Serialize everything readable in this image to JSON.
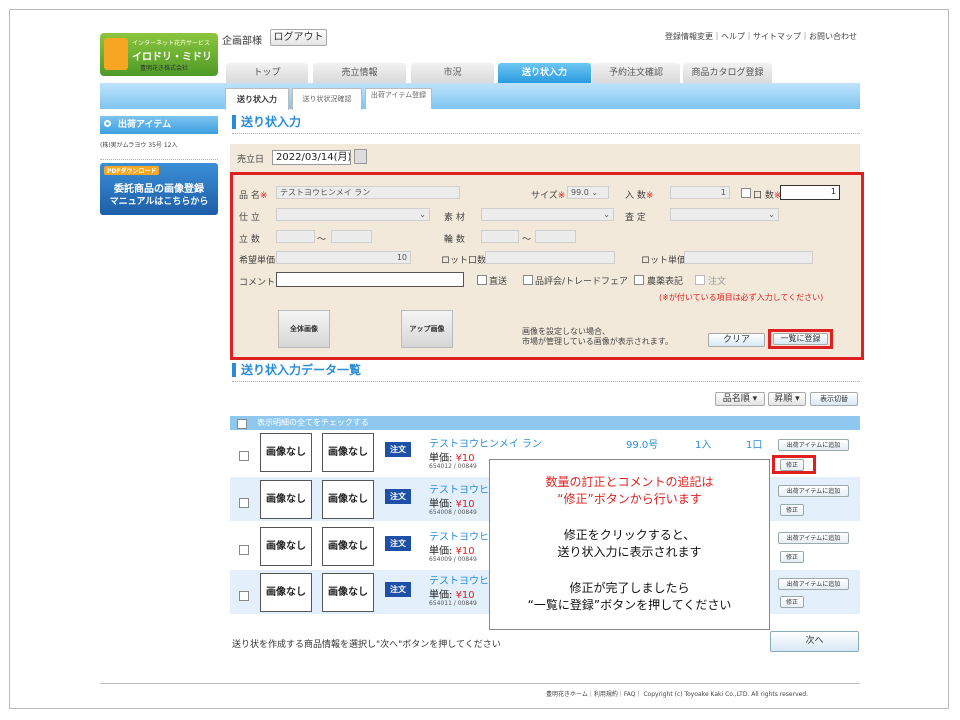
{
  "header": {
    "logo_tagline": "インターネット花卉サービス",
    "logo_name": "イロドリ・ミドリ",
    "logo_company": "豊明花き株式会社",
    "dept": "企画部様",
    "logout": "ログアウト",
    "links": "登録情報変更｜ヘルプ｜サイトマップ｜お問い合わせ"
  },
  "tabs": [
    "トップ",
    "売立情報",
    "市況",
    "送り状入力",
    "予約注文確認",
    "商品カタログ登録"
  ],
  "subtabs": [
    "送り状入力",
    "送り状状況確認",
    "出荷アイテム登録"
  ],
  "sidebar": {
    "head": "出荷アイテム",
    "count": "(株)実がムラヨウ 35号 12入",
    "pdf_tag": "PDFダウンロード",
    "banner_line1": "委託商品の画像登録",
    "banner_line2": "マニュアルはこちらから"
  },
  "form": {
    "title": "送り状入力",
    "date_label": "売立日",
    "date_value": "2022/03/14(月)",
    "name_label": "品 名",
    "name_value": "テストヨウヒンメイ ラン",
    "size_label": "サイズ",
    "size_value": "99.0",
    "irisu_label": "入 数",
    "irisu_value": "1",
    "kuchi_label": "口 数",
    "kuchi_value": "1",
    "shitate_label": "仕 立",
    "sozai_label": "素 材",
    "satei_label": "査 定",
    "tachisu_label": "立 数",
    "rinsu_label": "輪 数",
    "range_sep": "～",
    "kibou_label": "希望単価",
    "kibou_value": "10",
    "lot_kuchi_label": "ロット口数",
    "lot_price_label": "ロット単価",
    "comment_label": "コメント",
    "chk_chokuso": "直送",
    "chk_hinpyokai": "品評会/トレードフェア",
    "chk_nouyaku": "農薬表記",
    "chk_chumon": "注文",
    "required_note": "(※が付いている項目は必ず入力してください)",
    "cam_all": "全体画像",
    "cam_up": "アップ画像",
    "image_note1": "画像を設定しない場合、",
    "image_note2": "市場が管理している画像が表示されます。",
    "clear": "クリア",
    "register": "一覧に登録"
  },
  "list": {
    "title": "送り状入力データ一覧",
    "sort1": "品名順",
    "sort2": "昇順",
    "switch": "表示切替",
    "check_all": "表示明細の全てをチェックする",
    "no_image": "画像なし",
    "order": "注文",
    "add_item": "出荷アイテムに追加",
    "edit": "修正",
    "rows": [
      {
        "name": "テストヨウヒンメイ ラン",
        "price_label": "単価:",
        "price": "¥10",
        "code": "654012 / 00849",
        "size": "99.0号",
        "irisu": "1入",
        "kuchi": "1口"
      },
      {
        "name": "テストヨウヒ",
        "price_label": "単価:",
        "price": "¥10",
        "code": "654008 / 00849"
      },
      {
        "name": "テストヨウヒ",
        "price_label": "単価:",
        "price": "¥10",
        "code": "654009 / 00849"
      },
      {
        "name": "テストヨウヒ",
        "price_label": "単価:",
        "price": "¥10",
        "code": "654011 / 00849"
      }
    ],
    "bottom_note": "送り状を作成する商品情報を選択し\"次へ\"ボタンを押してください",
    "next": "次へ"
  },
  "callout": {
    "line1": "数量の訂正とコメントの追記は",
    "line2": "“修正”ボタンから行います",
    "line3": "修正をクリックすると、",
    "line4": "送り状入力に表示されます",
    "line5": "修正が完了しましたら",
    "line6": "“一覧に登録”ボタンを押してください"
  },
  "footer": "豊明花きホーム｜利用規約｜FAQ｜ Copyright (c) Toyoake Kaki Co.,LTD. All rights reserved.",
  "colors": {
    "accent": "#2a8cd8",
    "highlight": "#e02020",
    "form_bg": "#f2e9da",
    "order_badge": "#1f50a8"
  }
}
